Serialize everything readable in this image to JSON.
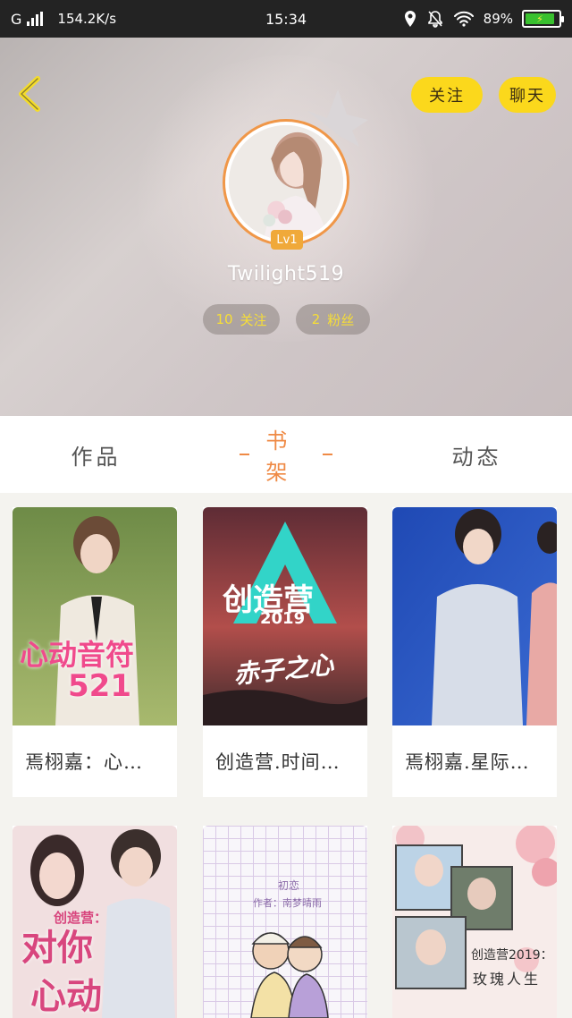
{
  "status_bar": {
    "network": "G",
    "speed": "154.2K/s",
    "time": "15:34",
    "battery": "89%"
  },
  "header": {
    "follow_button": "关注",
    "chat_button": "聊天",
    "level": "Lv1",
    "username": "Twilight519",
    "following_count": "10",
    "following_label": "关注",
    "fans_count": "2",
    "fans_label": "粉丝"
  },
  "tabs": {
    "works": "作品",
    "bookshelf": "书架",
    "feed": "动态",
    "active": "bookshelf"
  },
  "books": [
    {
      "title": "焉栩嘉：心…",
      "cover_line1": "心动音符",
      "cover_line2": "521"
    },
    {
      "title": "创造营.时间…",
      "cover_line1": "创造营",
      "cover_line2": "2019",
      "cover_line3": "赤子之心"
    },
    {
      "title": "焉栩嘉.星际…"
    },
    {
      "cover_line1": "创造营：",
      "cover_line2": "对你",
      "cover_line3": "心动"
    },
    {
      "cover_line1": "初恋",
      "cover_line2": "作者：南梦晴雨"
    },
    {
      "cover_line1": "创造营2019：",
      "cover_line2": "玫瑰人生"
    }
  ],
  "colors": {
    "accent_yellow": "#fbd81c",
    "tab_active": "#ef8a45",
    "stat_text": "#f7de36"
  }
}
